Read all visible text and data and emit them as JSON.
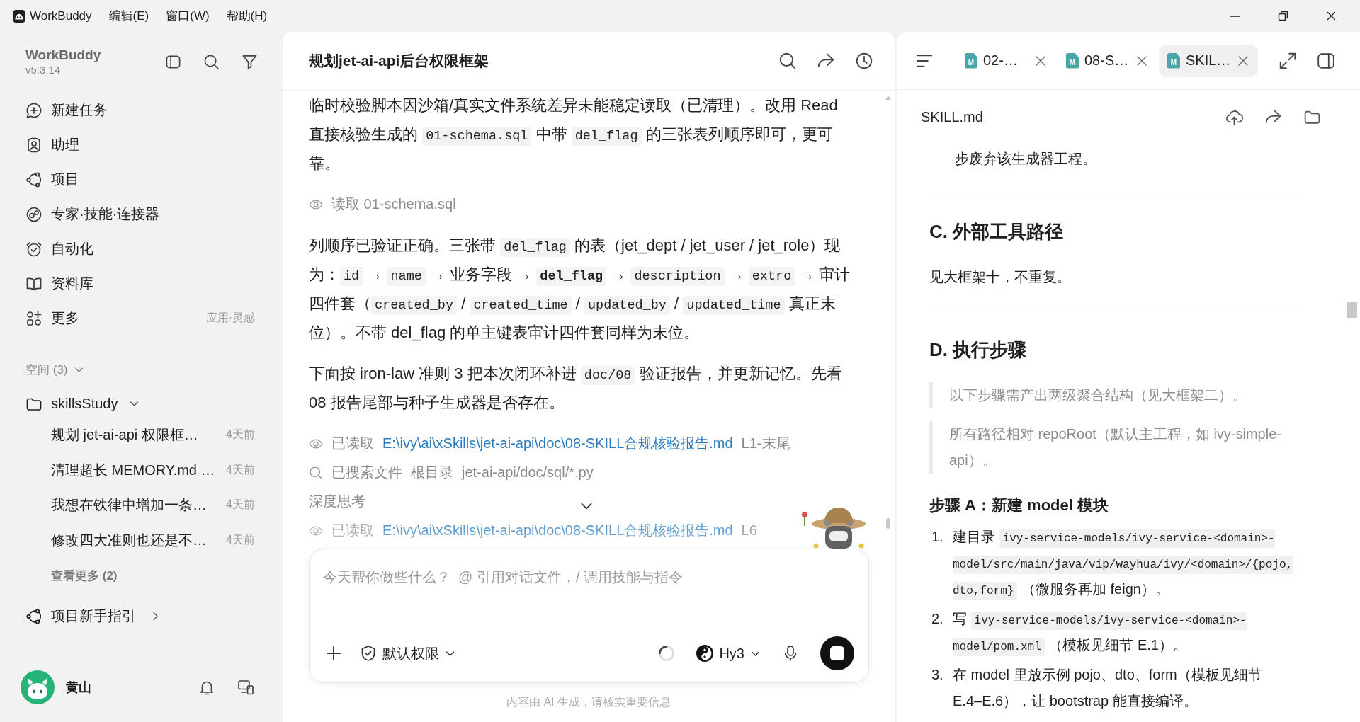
{
  "title_bar": {
    "app_name": "WorkBuddy",
    "menus": [
      "编辑(E)",
      "窗口(W)",
      "帮助(H)"
    ]
  },
  "sidebar": {
    "app_title": "WorkBuddy",
    "version": "v5.3.14",
    "nav_items": [
      {
        "label": "新建任务"
      },
      {
        "label": "助理"
      },
      {
        "label": "项目"
      },
      {
        "label": "专家·技能·连接器"
      },
      {
        "label": "自动化"
      },
      {
        "label": "资料库"
      },
      {
        "label": "更多",
        "hint": "应用·灵感"
      }
    ],
    "spaces_label": "空间 (3)",
    "project": {
      "name": "skillsStudy",
      "expanded": true,
      "tasks": [
        {
          "title": "规划 jet-ai-api 权限框…",
          "time": "4天前",
          "selected": false
        },
        {
          "title": "清理超长 MEMORY.md …",
          "time": "4天前",
          "selected": false
        },
        {
          "title": "我想在铁律中增加一条…",
          "time": "4天前",
          "selected": false
        },
        {
          "title": "修改四大准则也还是不…",
          "time": "4天前",
          "selected": false
        }
      ],
      "more": "查看更多 (2)"
    },
    "guide": "项目新手指引",
    "user": {
      "name": "黄山"
    }
  },
  "chat": {
    "title": "规划jet-ai-api后台权限框架",
    "blocks": [
      {
        "kind": "paragraph",
        "segments": [
          {
            "kind": "text",
            "text": "临时校验脚本因沙箱/真实文件系统差异未能稳定读取（已清理）。改用 Read 直接核验生成的 "
          },
          {
            "kind": "code",
            "text": "01-schema.sql"
          },
          {
            "kind": "text",
            "text": " 中带 "
          },
          {
            "kind": "code",
            "text": "del_flag"
          },
          {
            "kind": "text",
            "text": " 的三张表列顺序即可，更可靠。"
          }
        ]
      },
      {
        "kind": "read",
        "verb": "读取 01-schema.sql"
      },
      {
        "kind": "paragraph",
        "segments": [
          {
            "kind": "text",
            "text": "列顺序已验证正确。三张带 "
          },
          {
            "kind": "code",
            "text": "del_flag"
          },
          {
            "kind": "text",
            "text": " 的表（jet_dept / jet_user / jet_role）现为："
          },
          {
            "kind": "code",
            "text": "id"
          },
          {
            "kind": "text",
            "text": " → "
          },
          {
            "kind": "code",
            "text": "name"
          },
          {
            "kind": "text",
            "text": " → 业务字段 → "
          },
          {
            "kind": "code_strong",
            "text": "del_flag"
          },
          {
            "kind": "text",
            "text": " → "
          },
          {
            "kind": "code",
            "text": "description"
          },
          {
            "kind": "text",
            "text": " → "
          },
          {
            "kind": "code",
            "text": "extro"
          },
          {
            "kind": "text",
            "text": " → 审计四件套（"
          },
          {
            "kind": "code",
            "text": "created_by"
          },
          {
            "kind": "text",
            "text": " / "
          },
          {
            "kind": "code",
            "text": "created_time"
          },
          {
            "kind": "text",
            "text": " / "
          },
          {
            "kind": "code",
            "text": "updated_by"
          },
          {
            "kind": "text",
            "text": " / "
          },
          {
            "kind": "code",
            "text": "updated_time"
          },
          {
            "kind": "text",
            "text": " 真正末位）。不带 del_flag 的单主键表审计四件套同样为末位。"
          }
        ]
      },
      {
        "kind": "paragraph",
        "segments": [
          {
            "kind": "text",
            "text": "下面按 iron-law 准则 3 把本次闭环补进 "
          },
          {
            "kind": "code",
            "text": "doc/08"
          },
          {
            "kind": "text",
            "text": " 验证报告，并更新记忆。先看 08 报告尾部与种子生成器是否存在。"
          }
        ]
      },
      {
        "kind": "read",
        "verb": "已读取",
        "link": "E:\\ivy\\ai\\xSkills\\jet-ai-api\\doc\\08-SKILL合规核验报告.md",
        "range": "L1-末尾"
      },
      {
        "kind": "search",
        "verb": "已搜索文件",
        "scope": "根目录",
        "pattern": "jet-ai-api/doc/sql/*.py"
      },
      {
        "kind": "thinking",
        "verb": "深度思考"
      },
      {
        "kind": "read",
        "verb": "已读取",
        "link": "E:\\ivy\\ai\\xSkills\\jet-ai-api\\doc\\08-SKILL合规核验报告.md",
        "range": "L6"
      }
    ],
    "composer": {
      "placeholder": "今天帮你做些什么？  @ 引用对话文件，/ 调用技能与指令",
      "permission": "默认权限",
      "model": "Hy3",
      "busy": true
    },
    "disclaimer": "内容由 AI 生成，请核实重要信息"
  },
  "viewer": {
    "tabs": [
      {
        "label": "02-…",
        "badge": "M",
        "selected": false
      },
      {
        "label": "08-S…",
        "badge": "M",
        "selected": false
      },
      {
        "label": "SKIL…",
        "badge": "M",
        "selected": true
      }
    ],
    "file_name": "SKILL.md",
    "blocks": [
      {
        "kind": "continuation",
        "text": "步废弃该生成器工程。"
      },
      {
        "kind": "rule"
      },
      {
        "kind": "heading",
        "text": "C. 外部工具路径"
      },
      {
        "kind": "paragraph",
        "text": "见大框架十，不重复。"
      },
      {
        "kind": "rule"
      },
      {
        "kind": "heading",
        "text": "D. 执行步骤"
      },
      {
        "kind": "quote",
        "text": "以下步骤需产出两级聚合结构（见大框架二）。"
      },
      {
        "kind": "quote",
        "text": "所有路径相对 repoRoot（默认主工程，如 ivy-simple-api）。"
      },
      {
        "kind": "subheading",
        "text": "步骤 A：新建 model 模块"
      },
      {
        "kind": "list_item",
        "number": "1.",
        "segments": [
          {
            "kind": "text",
            "text": "建目录 "
          },
          {
            "kind": "code",
            "text": "ivy-service-models/ivy-service-<domain>-model/src/main/java/vip/wayhua/ivy/<domain>/{pojo,dto,form}"
          },
          {
            "kind": "text",
            "text": " （微服务再加 feign）。"
          }
        ]
      },
      {
        "kind": "list_item",
        "number": "2.",
        "segments": [
          {
            "kind": "text",
            "text": "写 "
          },
          {
            "kind": "code",
            "text": "ivy-service-models/ivy-service-<domain>-model/pom.xml"
          },
          {
            "kind": "text",
            "text": " （模板见细节 E.1）。"
          }
        ]
      },
      {
        "kind": "list_item",
        "number": "3.",
        "segments": [
          {
            "kind": "text",
            "text": "在 model 里放示例 pojo、dto、form（模板见细节 E.4–E.6），让 bootstrap 能直接编译。"
          }
        ]
      }
    ]
  }
}
